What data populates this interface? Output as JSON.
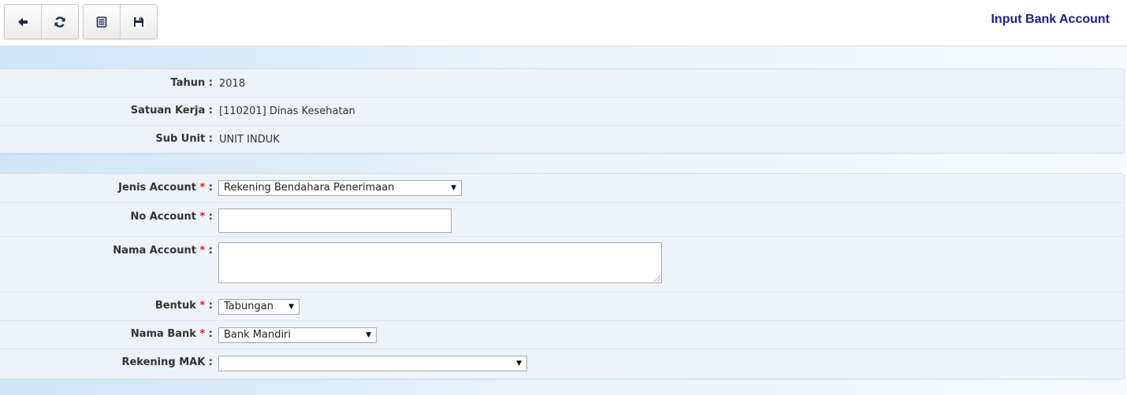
{
  "toolbar": {
    "buttons": [
      {
        "name": "back",
        "icon": "arrow-left-icon"
      },
      {
        "name": "refresh",
        "icon": "refresh-icon"
      },
      {
        "name": "list",
        "icon": "list-icon"
      },
      {
        "name": "save",
        "icon": "save-icon"
      }
    ],
    "title": "Input Bank Account"
  },
  "info": {
    "tahun": {
      "label": "Tahun",
      "value": "2018"
    },
    "satuan_kerja": {
      "label": "Satuan Kerja",
      "value": "[110201] Dinas Kesehatan"
    },
    "sub_unit": {
      "label": "Sub Unit",
      "value": "UNIT INDUK"
    },
    "separator": ":"
  },
  "form": {
    "jenis_account": {
      "label": "Jenis Account",
      "value": "Rekening Bendahara Penerimaan"
    },
    "no_account": {
      "label": "No Account",
      "value": ""
    },
    "nama_account": {
      "label": "Nama Account",
      "value": ""
    },
    "bentuk": {
      "label": "Bentuk",
      "value": "Tabungan"
    },
    "nama_bank": {
      "label": "Nama Bank",
      "value": "Bank Mandiri"
    },
    "rekening_mak": {
      "label": "Rekening MAK",
      "value": ""
    },
    "required_mark": "*",
    "separator": ":"
  },
  "colors": {
    "title": "#1a237e",
    "required": "#e02020",
    "panel": "#edf3f9",
    "band": "#cfe5f6"
  }
}
